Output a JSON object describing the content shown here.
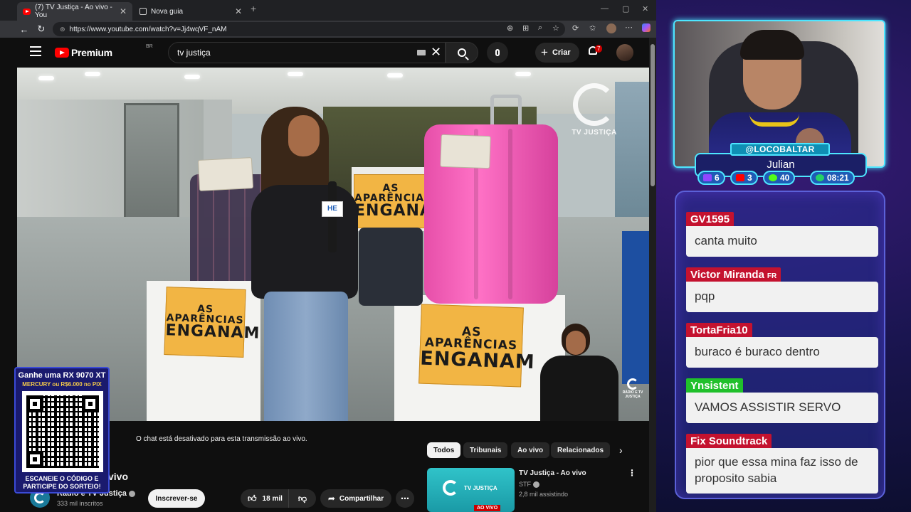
{
  "browser": {
    "tabs": [
      {
        "label": "(7) TV Justiça - Ao vivo - You",
        "active": true
      },
      {
        "label": "Nova guia",
        "active": false
      }
    ],
    "url": "https://www.youtube.com/watch?v=Jj4wqVF_nAM"
  },
  "youtube": {
    "logo_text": "Premium",
    "region": "BR",
    "search_value": "tv justiça",
    "create_label": "Criar",
    "notification_count": "7",
    "video": {
      "logo_text": "TV JUSTIÇA",
      "sign_line1": "AS APARÊNCIAS",
      "sign_line2": "ENGANAM",
      "mic_flag": "HE",
      "radio_logo": "RÁDIO E TV JUSTIÇA"
    },
    "chat_disabled": "O chat está desativado para esta transmissão ao vivo.",
    "title_fragment": "vivo",
    "channel_name": "Rádio e TV Justiça",
    "subscribers": "333 mil inscritos",
    "subscribe_label": "Inscrever-se",
    "likes": "18 mil",
    "share_label": "Compartilhar",
    "chips": [
      "Todos",
      "Tribunais",
      "Ao vivo",
      "Relacionados"
    ],
    "recommendation": {
      "title": "TV Justiça - Ao vivo",
      "channel": "STF",
      "viewers": "2,8 mil assistindo",
      "thumb_logo": "TV JUSTIÇA",
      "badge": "AO VIVO"
    }
  },
  "giveaway": {
    "title": "Ganhe uma RX 9070 XT",
    "subtitle": "MERCURY ou R$6.000 no PIX",
    "cta_line1": "ESCANEIE O CÓDIGO E",
    "cta_line2": "PARTICIPE DO SORTEIO!"
  },
  "streamer": {
    "handle": "@LOCOBALTAR",
    "name": "Julian",
    "stats": [
      {
        "icon": "twitch-icon",
        "value": "6",
        "color": "#9146ff"
      },
      {
        "icon": "youtube-icon",
        "value": "3",
        "color": "#ff0000"
      },
      {
        "icon": "kick-icon",
        "value": "40",
        "color": "#53fc18"
      },
      {
        "icon": "clock-icon",
        "value": "08:21",
        "color": "#25d366"
      }
    ]
  },
  "chat": [
    {
      "user": "GV1595",
      "text": "canta muito",
      "color": "red",
      "flag": ""
    },
    {
      "user": "Victor Miranda",
      "text": "pqp",
      "color": "red",
      "flag": "FR"
    },
    {
      "user": "TortaFria10",
      "text": "buraco é buraco dentro",
      "color": "red",
      "flag": ""
    },
    {
      "user": "Ynsistent",
      "text": "VAMOS ASSISTIR SERVO",
      "color": "green",
      "flag": ""
    },
    {
      "user": "Fix Soundtrack",
      "text": "pior que essa mina faz isso de proposito sabia",
      "color": "red",
      "flag": ""
    }
  ]
}
